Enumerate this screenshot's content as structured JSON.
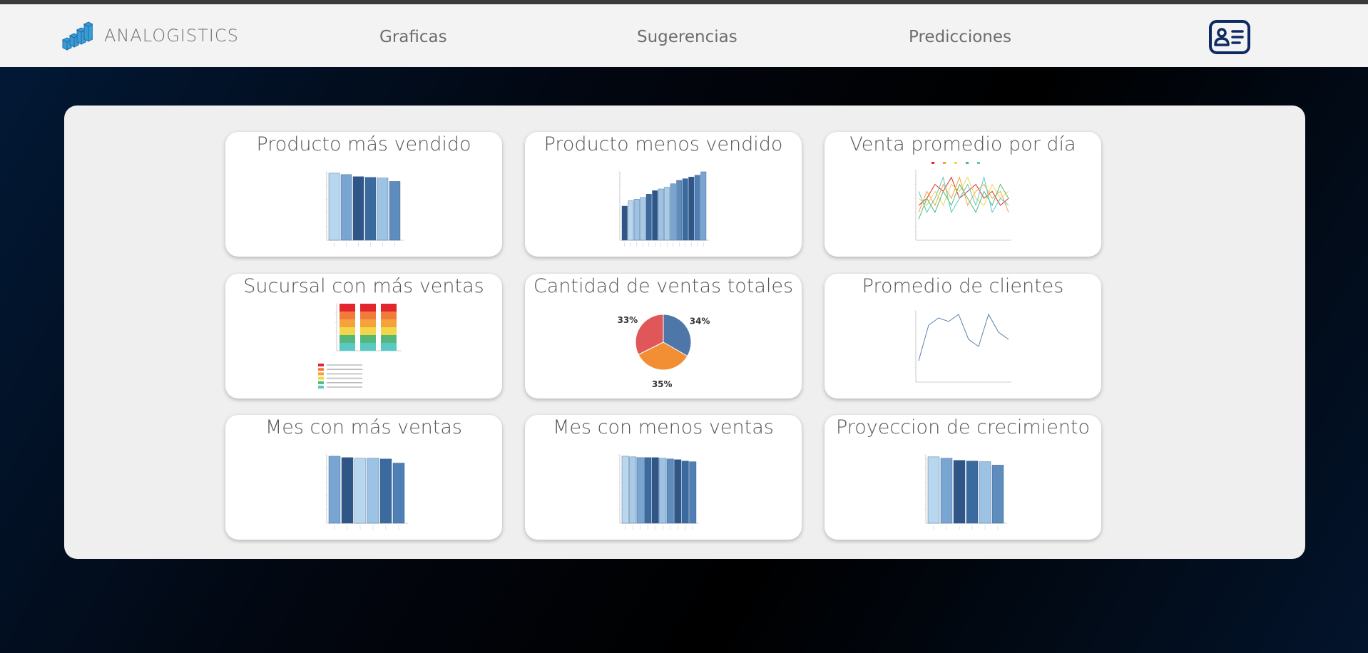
{
  "app": {
    "brand": "ANALOGISTICS"
  },
  "nav": {
    "items": [
      {
        "label": "Graficas"
      },
      {
        "label": "Sugerencias"
      },
      {
        "label": "Predicciones"
      }
    ]
  },
  "colors": {
    "navbar": "#f3f3f3",
    "panel": "#efefef",
    "card": "#ffffff",
    "bar_light": "#a9cbe6",
    "bar_mid": "#6b95c4",
    "bar_dark": "#2f5686",
    "icon_dark": "#0e2a63",
    "brand_icon": "#3a9bd5"
  },
  "cards": [
    {
      "title": "Producto más vendido"
    },
    {
      "title": "Producto menos vendido"
    },
    {
      "title": "Venta promedio por día"
    },
    {
      "title": "Sucursal con más ventas"
    },
    {
      "title": "Cantidad de ventas totales"
    },
    {
      "title": "Promedio de clientes"
    },
    {
      "title": "Mes con más ventas"
    },
    {
      "title": "Mes con menos ventas"
    },
    {
      "title": "Proyeccion de crecimiento"
    }
  ],
  "icons": {
    "brand": "bar-chart-cubes-icon",
    "profile": "id-card-icon"
  },
  "chart_data": [
    {
      "type": "bar",
      "card": "Producto más vendido",
      "values": [
        98,
        96,
        93,
        92,
        91,
        86
      ],
      "ylim": [
        0,
        100
      ]
    },
    {
      "type": "bar",
      "card": "Producto menos vendido",
      "values": [
        20,
        23,
        24,
        25,
        27,
        29,
        30,
        31,
        33,
        35,
        36,
        37,
        38,
        40
      ],
      "ylim": [
        0,
        40
      ]
    },
    {
      "type": "line",
      "card": "Venta promedio por día",
      "series": [
        {
          "values": [
            5,
            6,
            8,
            7,
            9,
            6,
            7,
            8,
            6,
            7,
            5,
            6
          ]
        },
        {
          "values": [
            4,
            7,
            5,
            8,
            6,
            9,
            5,
            7,
            8,
            6,
            7,
            4
          ]
        },
        {
          "values": [
            6,
            5,
            7,
            5,
            8,
            7,
            9,
            6,
            5,
            8,
            6,
            7
          ]
        },
        {
          "values": [
            3,
            6,
            4,
            7,
            5,
            8,
            6,
            4,
            7,
            5,
            8,
            6
          ]
        },
        {
          "values": [
            7,
            4,
            6,
            9,
            4,
            6,
            8,
            5,
            9,
            4,
            6,
            5
          ]
        }
      ],
      "ylim": [
        0,
        10
      ]
    },
    {
      "type": "bar",
      "card": "Sucursal con más ventas",
      "stacked": true,
      "series": [
        {
          "values": [
            2,
            2,
            2
          ]
        },
        {
          "values": [
            2,
            2,
            2
          ]
        },
        {
          "values": [
            2,
            2,
            2
          ]
        },
        {
          "values": [
            2,
            2,
            2
          ]
        },
        {
          "values": [
            2,
            2,
            2
          ]
        },
        {
          "values": [
            2,
            2,
            2
          ]
        }
      ],
      "colors": [
        "#58c9c5",
        "#55b77a",
        "#f1d64a",
        "#f6a23a",
        "#f17b3a",
        "#e3262e"
      ]
    },
    {
      "type": "pie",
      "card": "Cantidad de ventas totales",
      "values": [
        34,
        35,
        33
      ],
      "labels": [
        "34%",
        "35%",
        "33%"
      ],
      "colors": [
        "#4f76a8",
        "#f28e33",
        "#e05759"
      ]
    },
    {
      "type": "line",
      "card": "Promedio de clientes",
      "series": [
        {
          "values": [
            3,
            8,
            9,
            8.5,
            9.5,
            6,
            5,
            9.5,
            7,
            6
          ]
        }
      ],
      "ylim": [
        0,
        10
      ]
    },
    {
      "type": "bar",
      "card": "Mes con más ventas",
      "values": [
        98,
        96,
        95,
        95,
        94,
        88
      ],
      "ylim": [
        0,
        100
      ]
    },
    {
      "type": "bar",
      "card": "Mes con menos ventas",
      "values": [
        98,
        97,
        96,
        96,
        96,
        95,
        94,
        93,
        91,
        90
      ],
      "ylim": [
        0,
        100
      ]
    },
    {
      "type": "bar",
      "card": "Proyeccion de crecimiento",
      "values": [
        97,
        95,
        92,
        91,
        90,
        85
      ],
      "ylim": [
        0,
        100
      ]
    }
  ]
}
